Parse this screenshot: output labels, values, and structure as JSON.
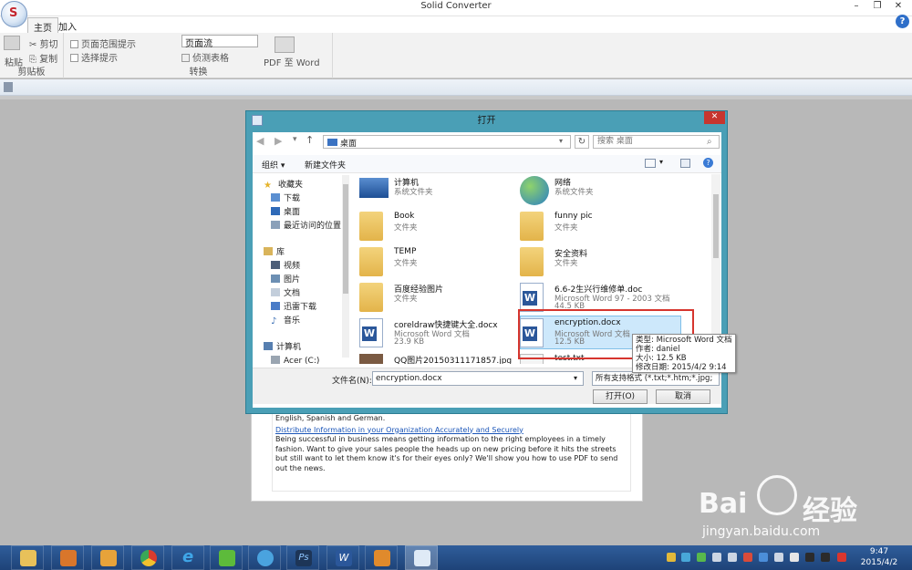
{
  "app": {
    "title": "Solid Converter"
  },
  "window_controls": {
    "minimize": "–",
    "restore": "❐",
    "close": "✕"
  },
  "ribbon_tabs": [
    "主页",
    "加入"
  ],
  "ribbon": {
    "clipboard": {
      "paste": "粘贴",
      "cut": "剪切",
      "copy": "复制",
      "group": "剪贴板"
    },
    "options": {
      "page_range": "页面范围提示",
      "select_prompt": "选择提示",
      "layout_select": "页面流",
      "detect_tables": "侦测表格",
      "pdf_to_word": "PDF 至 Word",
      "group": "转换"
    }
  },
  "dialog": {
    "title": "打开",
    "breadcrumb": "桌面",
    "search_placeholder": "搜索 桌面",
    "organize": "组织 ▾",
    "new_folder": "新建文件夹",
    "nav": {
      "favorites": "收藏夹",
      "downloads": "下载",
      "desktop": "桌面",
      "recent": "最近访问的位置",
      "library": "库",
      "videos": "视频",
      "pictures": "图片",
      "documents": "文档",
      "thunder": "迅雷下载",
      "music": "音乐",
      "computer": "计算机",
      "acer": "Acer (C:)"
    },
    "files": [
      {
        "name": "计算机",
        "type": "系统文件夹",
        "size": ""
      },
      {
        "name": "网络",
        "type": "系统文件夹",
        "size": ""
      },
      {
        "name": "Book",
        "type": "文件夹",
        "size": ""
      },
      {
        "name": "funny pic",
        "type": "文件夹",
        "size": ""
      },
      {
        "name": "TEMP",
        "type": "文件夹",
        "size": ""
      },
      {
        "name": "安全资料",
        "type": "文件夹",
        "size": ""
      },
      {
        "name": "百度经验图片",
        "type": "文件夹",
        "size": ""
      },
      {
        "name": "6.6-2生兴行维修单.doc",
        "type": "Microsoft Word 97 - 2003 文档",
        "size": "44.5 KB"
      },
      {
        "name": "coreldraw快捷键大全.docx",
        "type": "Microsoft Word 文档",
        "size": "23.9 KB"
      },
      {
        "name": "encryption.docx",
        "type": "Microsoft Word 文档",
        "size": "12.5 KB"
      },
      {
        "name": "QQ图片20150311171857.jpg",
        "type": "",
        "size": ""
      },
      {
        "name": "test.txt",
        "type": "",
        "size": ""
      }
    ],
    "tooltip": {
      "type": "类型: Microsoft Word 文档",
      "author": "作者: daniel",
      "size": "大小: 12.5 KB",
      "modified": "修改日期: 2015/4/2 9:14"
    },
    "filename_label": "文件名(N):",
    "filename_value": "encryption.docx",
    "filter": "所有支持格式 (*.txt;*.htm;*.jpg;",
    "open": "打开(O)",
    "cancel": "取消"
  },
  "document": {
    "line0": "English, Spanish and German.",
    "link": "Distribute Information in your Organization Accurately and Securely",
    "body": "Being successful in business means getting information to the right employees in a timely fashion. Want to give your sales people the heads up on new pricing before it hits the streets but still want to let them know it's for their eyes only? We'll show you how to use PDF to send out the news."
  },
  "clock": {
    "time": "9:47",
    "date": "2015/4/2"
  },
  "watermark": {
    "brand": "Bai",
    "brand2": "经验",
    "url": "jingyan.baidu.com"
  },
  "colors": {
    "dialog_frame": "#4a9fb6",
    "selection_border": "#d6352e",
    "taskbar": "#1e4378",
    "link": "#1a55b8"
  }
}
